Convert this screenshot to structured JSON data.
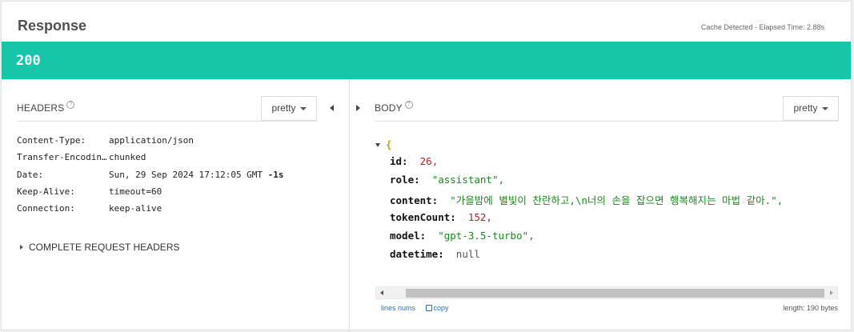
{
  "response": {
    "title": "Response",
    "meta": "Cache Detected - Elapsed Time: 2.88s",
    "status_code": "200"
  },
  "headers": {
    "title": "HEADERS",
    "help": "?",
    "format_label": "pretty",
    "rows": [
      {
        "key": "Content-Type:",
        "value": "application/json"
      },
      {
        "key": "Transfer-Encodin…",
        "value": "chunked"
      },
      {
        "key": "Date:",
        "value": "Sun, 29 Sep 2024 17:12:05 GMT",
        "suffix": "-1s"
      },
      {
        "key": "Keep-Alive:",
        "value": "timeout=60"
      },
      {
        "key": "Connection:",
        "value": "keep-alive"
      }
    ],
    "complete_label": "COMPLETE REQUEST HEADERS"
  },
  "body": {
    "title": "BODY",
    "help": "?",
    "format_label": "pretty",
    "brace": "{",
    "json": [
      {
        "key": "id:",
        "value": "26,",
        "type": "num"
      },
      {
        "key": "role:",
        "value": "\"assistant\",",
        "type": "str"
      },
      {
        "key": "content:",
        "value": "\"가을밤에 별빛이 찬란하고,\\n너의 손을 잡으면 행복해지는 마법 같아.\",",
        "type": "str"
      },
      {
        "key": "tokenCount:",
        "value": "152,",
        "type": "num"
      },
      {
        "key": "model:",
        "value": "\"gpt-3.5-turbo\",",
        "type": "str"
      },
      {
        "key": "datetime:",
        "value": "null",
        "type": "null"
      }
    ],
    "lines_nums_label": "lines nums",
    "copy_label": "copy",
    "length_label": "length: 190 bytes"
  },
  "colors": {
    "status_bg": "#17c6a6",
    "string": "#1a8a1a",
    "number": "#b22222",
    "link": "#2a6fb5"
  }
}
